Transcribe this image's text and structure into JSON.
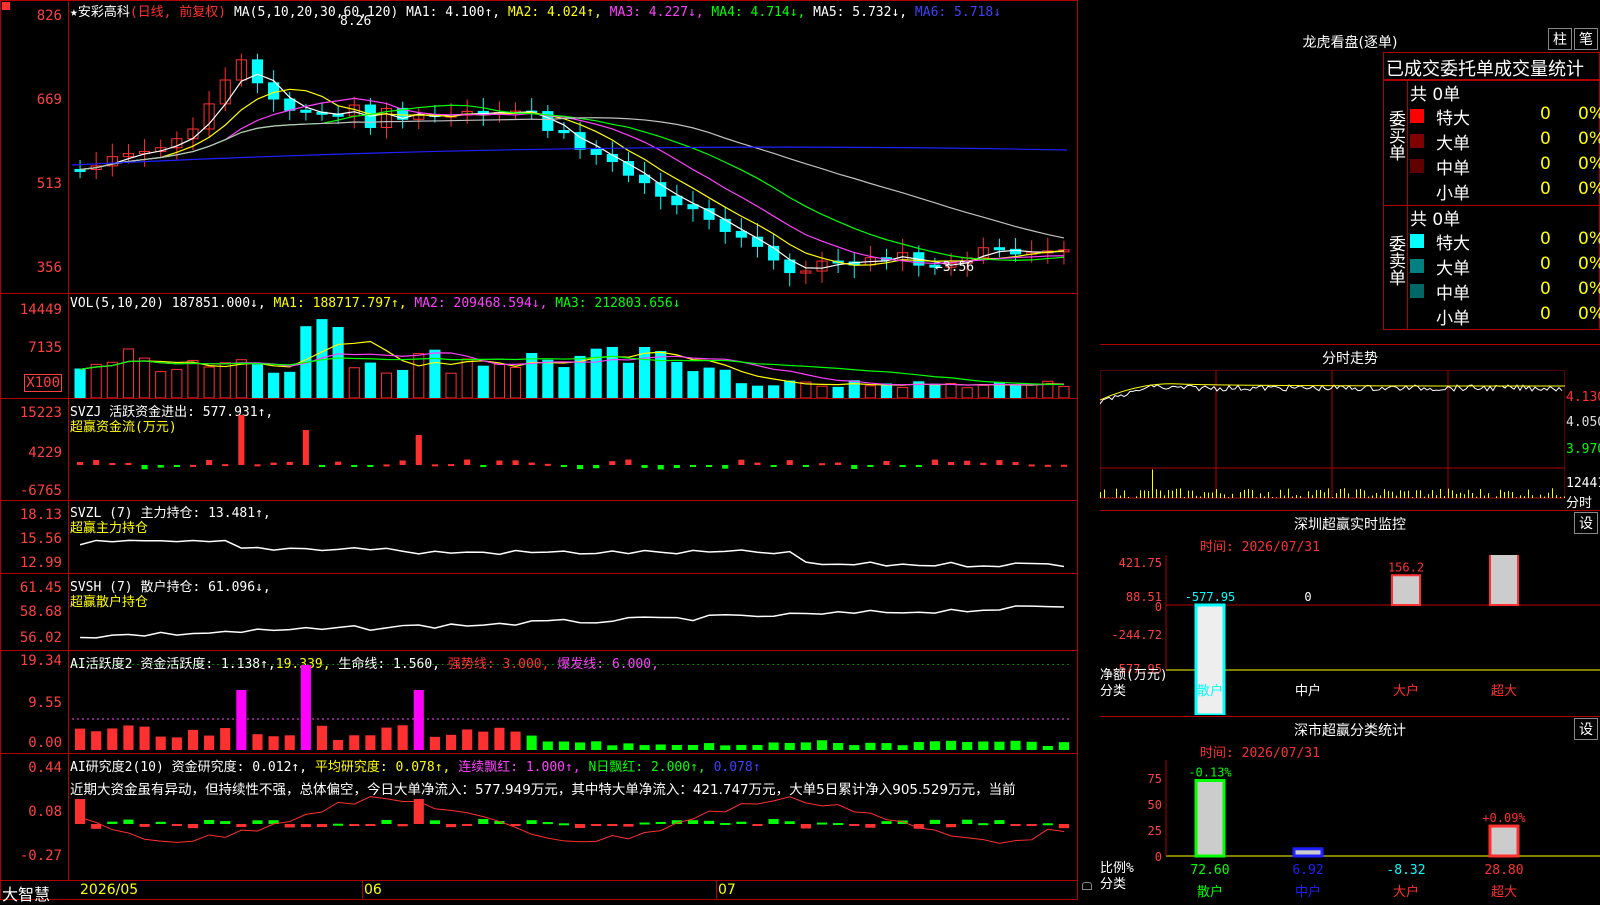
{
  "colors": {
    "up": "#ff3030",
    "down": "#00ffff",
    "ma1": "#ffffff",
    "ma2": "#ffff00",
    "ma3": "#ff40ff",
    "ma4": "#00ff00",
    "ma5": "#c0c0c0",
    "ma6": "#2020ff",
    "grid": "#b00000",
    "axis": "#ff4040"
  },
  "main": {
    "title": "★安彩高科",
    "mode": "(日线, 前复权)",
    "ma_def": "MA(5,10,20,30,60,120)",
    "ma1": "MA1: 4.100↑,",
    "ma2": "MA2: 4.024↑,",
    "ma3": "MA3: 4.227↓,",
    "ma4": "MA4: 4.714↓,",
    "ma5": "MA5: 5.732↓,",
    "ma6": "MA6: 5.718↓",
    "yticks": [
      "826",
      "669",
      "513",
      "356"
    ],
    "high_label": "8.26",
    "low_label": "←3.56"
  },
  "vol": {
    "def": "VOL(5,10,20)",
    "value": "187851.000↓,",
    "ma1": "MA1: 188717.797↑,",
    "ma2": "MA2: 209468.594↓,",
    "ma3": "MA3: 212803.656↓",
    "yticks": [
      "14449",
      "7135"
    ],
    "unit": "X100"
  },
  "svzj": {
    "def": "SVZJ",
    "name": "活跃资金进出: 577.931↑,",
    "sub": "超赢资金流(万元)",
    "yticks": [
      "15223",
      "4229",
      "-6765"
    ]
  },
  "svzl": {
    "def": "SVZL (7)",
    "name": "主力持仓: 13.481↑,",
    "sub": "超赢主力持仓",
    "yticks": [
      "18.13",
      "15.56",
      "12.99"
    ]
  },
  "svsh": {
    "def": "SVSH (7)",
    "name": "散户持仓: 61.096↓,",
    "sub": "超赢散户持仓",
    "yticks": [
      "61.45",
      "58.68",
      "56.02"
    ]
  },
  "ai1": {
    "def": "AI活跃度2",
    "a": "资金活跃度: 1.138↑,",
    "b": "19.339,",
    "c": "生命线: 1.560,",
    "d": "强势线: 3.000,",
    "e": "爆发线: 6.000,",
    "yticks": [
      "19.34",
      "9.55",
      "0.00"
    ]
  },
  "ai2": {
    "def": "AI研究度2(10)",
    "a": "资金研究度: 0.012↑,",
    "b": "平均研究度: 0.078↑,",
    "c": "连续飘红: 1.000↑,",
    "d": "N日飘红: 2.000↑,",
    "e": "0.078↑",
    "note": "近期大资金虽有异动，但持续性不强，总体偏空，今日大单净流入：577.949万元，其中特大单净流入：421.747万元，大单5日累计净入905.529万元，当前",
    "yticks": [
      "0.44",
      "0.08",
      "-0.27"
    ]
  },
  "xaxis": {
    "brand": "大智慧",
    "labels": [
      "2026/05",
      "06",
      "07"
    ]
  },
  "lhb": {
    "title": "龙虎看盘(逐单)",
    "btn1": "柱",
    "btn2": "笔",
    "tabs": "已成交委托单成交量统计",
    "buy": {
      "side": "委买单",
      "count": "共 0单",
      "rows": [
        {
          "name": "特大",
          "v": "0",
          "p": "0%"
        },
        {
          "name": "大单",
          "v": "0",
          "p": "0%"
        },
        {
          "name": "中单",
          "v": "0",
          "p": "0%"
        },
        {
          "name": "小单",
          "v": "0",
          "p": "0%"
        }
      ]
    },
    "sell": {
      "side": "委卖单",
      "count": "共 0单",
      "rows": [
        {
          "name": "特大",
          "v": "0",
          "p": "0%"
        },
        {
          "name": "大单",
          "v": "0",
          "p": "0%"
        },
        {
          "name": "中单",
          "v": "0",
          "p": "0%"
        },
        {
          "name": "小单",
          "v": "0",
          "p": "0%"
        }
      ]
    }
  },
  "fenshi": {
    "title": "分时走势",
    "labels": [
      "4.130",
      "4.050",
      "3.970",
      "12441",
      "分时"
    ]
  },
  "sz_monitor": {
    "title": "深圳超赢实时监控",
    "btn": "设",
    "time": "时间: 2026/07/31",
    "yticks": [
      "421.75",
      "88.51",
      "0",
      "-244.72",
      "-577.95"
    ],
    "ylab1": "净额(万元)",
    "ylab2": "分类",
    "bars": [
      {
        "cat": "散户",
        "value": -577.95,
        "label": "-577.95"
      },
      {
        "cat": "中户",
        "value": 0,
        "label": "0"
      },
      {
        "cat": "大户",
        "value": 156.2,
        "label": "156.2"
      },
      {
        "cat": "超大",
        "value": 421.75,
        "label": "421.75"
      }
    ]
  },
  "sz_class": {
    "title": "深市超赢分类统计",
    "btn": "设",
    "time": "时间: 2026/07/31",
    "yticks": [
      "75",
      "50",
      "25",
      "0"
    ],
    "ylab1": "比例%",
    "ylab2": "分类",
    "bars": [
      {
        "cat": "散户",
        "value": 72.6,
        "label": "72.60",
        "chg": "-0.13%"
      },
      {
        "cat": "中户",
        "value": 6.92,
        "label": "6.92",
        "chg": ""
      },
      {
        "cat": "大户",
        "value": -8.32,
        "label": "-8.32",
        "chg": ""
      },
      {
        "cat": "超大",
        "value": 28.8,
        "label": "28.80",
        "chg": "+0.09%"
      }
    ]
  }
}
